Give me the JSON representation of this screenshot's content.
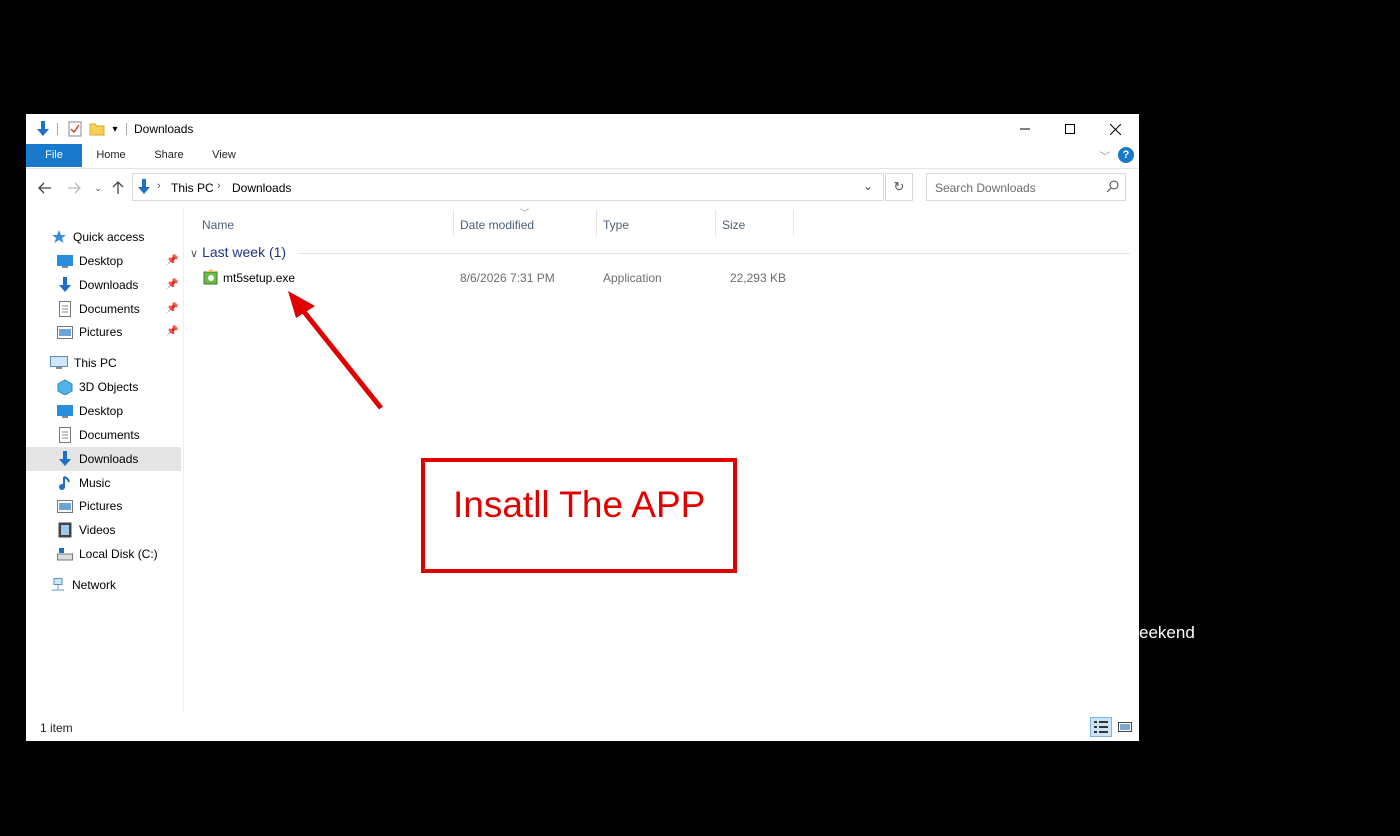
{
  "window": {
    "title": "Downloads"
  },
  "ribbon": {
    "tabs": [
      "File",
      "Home",
      "Share",
      "View"
    ],
    "help": "?"
  },
  "nav": {
    "breadcrumb": [
      "This PC",
      "Downloads"
    ],
    "search_placeholder": "Search Downloads"
  },
  "sidebar": {
    "quick_access": "Quick access",
    "quick_items": [
      "Desktop",
      "Downloads",
      "Documents",
      "Pictures"
    ],
    "this_pc": "This PC",
    "pc_items": [
      "3D Objects",
      "Desktop",
      "Documents",
      "Downloads",
      "Music",
      "Pictures",
      "Videos",
      "Local Disk (C:)"
    ],
    "network": "Network"
  },
  "columns": [
    "Name",
    "Date modified",
    "Type",
    "Size"
  ],
  "group": {
    "label": "Last week (1)"
  },
  "files": [
    {
      "name": "mt5setup.exe",
      "date": "8/6/2026 7:31 PM",
      "type": "Application",
      "size": "22,293 KB"
    }
  ],
  "status": {
    "count": "1 item"
  },
  "annotation": {
    "text": "Insatll The APP"
  },
  "background": {
    "text": "eekend"
  },
  "colors": {
    "file_tab": "#1979ca",
    "annotation": "#e00000",
    "selected": "#e5e5e5"
  }
}
